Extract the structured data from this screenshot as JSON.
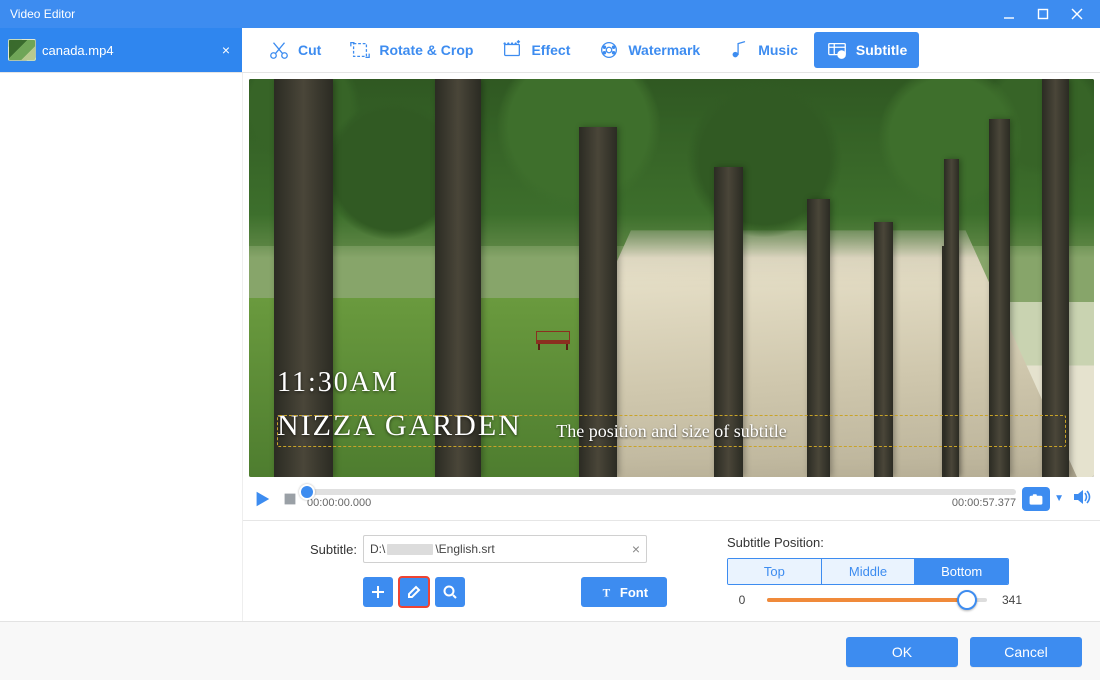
{
  "window": {
    "title": "Video Editor"
  },
  "file_tab": {
    "name": "canada.mp4"
  },
  "toolbar": {
    "cut": "Cut",
    "rotate": "Rotate & Crop",
    "effect": "Effect",
    "watermark": "Watermark",
    "music": "Music",
    "subtitle": "Subtitle",
    "active": "subtitle"
  },
  "preview": {
    "overlay_time": "11:30AM",
    "overlay_place": "NIZZA GARDEN",
    "subtitle_guide": "The position and size of subtitle"
  },
  "playback": {
    "current": "00:00:00.000",
    "total": "00:00:57.377"
  },
  "subtitle_panel": {
    "label": "Subtitle:",
    "path_pre": "D:\\",
    "path_post": "\\English.srt",
    "font_button": "Font"
  },
  "position_panel": {
    "label": "Subtitle Position:",
    "options": {
      "top": "Top",
      "middle": "Middle",
      "bottom": "Bottom"
    },
    "selected": "bottom",
    "slider_min": 0,
    "slider_max": 341,
    "slider_value": 310
  },
  "footer": {
    "ok": "OK",
    "cancel": "Cancel"
  }
}
